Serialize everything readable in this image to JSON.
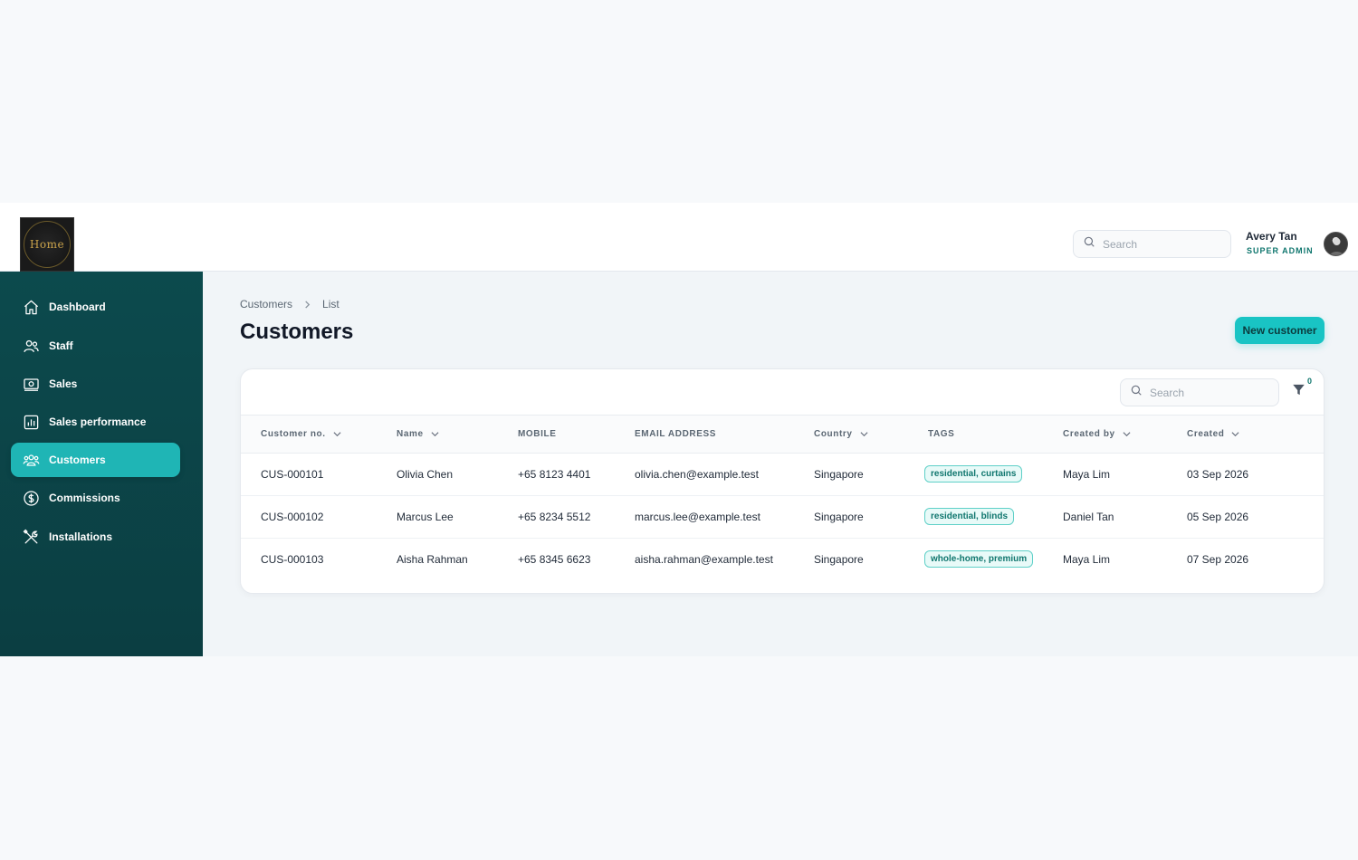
{
  "app": {
    "logo_text": "Home",
    "brand_color": "#0c4a4d",
    "accent_color": "#19c4c4"
  },
  "header": {
    "search_placeholder": "Search",
    "user_name": "Avery Tan",
    "user_role": "SUPER ADMIN"
  },
  "sidebar": {
    "items": [
      {
        "label": "Dashboard",
        "icon": "home-icon"
      },
      {
        "label": "Staff",
        "icon": "users-icon"
      },
      {
        "label": "Sales",
        "icon": "cash-icon"
      },
      {
        "label": "Sales performance",
        "icon": "bar-chart-icon"
      },
      {
        "label": "Customers",
        "icon": "customers-icon",
        "active": true
      },
      {
        "label": "Commissions",
        "icon": "dollar-circle-icon"
      },
      {
        "label": "Installations",
        "icon": "tools-icon"
      }
    ]
  },
  "page": {
    "breadcrumb": [
      "Customers",
      "List"
    ],
    "title": "Customers",
    "new_button_label": "New customer"
  },
  "table": {
    "search_placeholder": "Search",
    "filter_count": "0",
    "columns": [
      "Customer no.",
      "Name",
      "MOBILE",
      "EMAIL ADDRESS",
      "Country",
      "TAGS",
      "Created by",
      "Created"
    ],
    "rows": [
      {
        "customer_no": "CUS-000101",
        "name": "Olivia Chen",
        "mobile": "+65 8123 4401",
        "email": "olivia.chen@example.test",
        "country": "Singapore",
        "tags": "residential, curtains",
        "created_by": "Maya Lim",
        "created": "03 Sep 2026"
      },
      {
        "customer_no": "CUS-000102",
        "name": "Marcus Lee",
        "mobile": "+65 8234 5512",
        "email": "marcus.lee@example.test",
        "country": "Singapore",
        "tags": "residential, blinds",
        "created_by": "Daniel Tan",
        "created": "05 Sep 2026"
      },
      {
        "customer_no": "CUS-000103",
        "name": "Aisha Rahman",
        "mobile": "+65 8345 6623",
        "email": "aisha.rahman@example.test",
        "country": "Singapore",
        "tags": "whole-home, premium",
        "created_by": "Maya Lim",
        "created": "07 Sep 2026"
      }
    ]
  }
}
